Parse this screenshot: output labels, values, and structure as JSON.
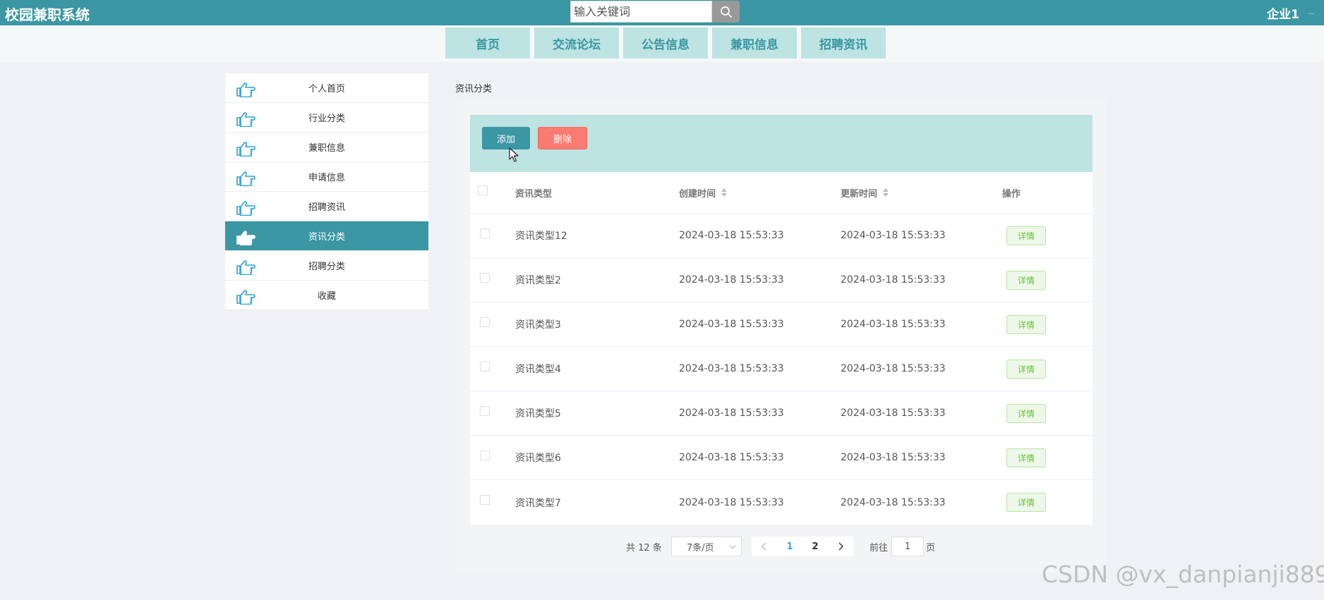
{
  "header": {
    "brand": "校园兼职系统",
    "search_placeholder": "输入关键词",
    "user": "企业1"
  },
  "nav": {
    "items": [
      {
        "label": "首页"
      },
      {
        "label": "交流论坛"
      },
      {
        "label": "公告信息"
      },
      {
        "label": "兼职信息"
      },
      {
        "label": "招聘资讯"
      }
    ]
  },
  "sidebar": {
    "items": [
      {
        "label": "个人首页",
        "icon": "pointing-hand-icon"
      },
      {
        "label": "行业分类",
        "icon": "pointing-hand-icon"
      },
      {
        "label": "兼职信息",
        "icon": "pointing-hand-icon"
      },
      {
        "label": "申请信息",
        "icon": "pointing-hand-icon"
      },
      {
        "label": "招聘资讯",
        "icon": "pointing-hand-icon"
      },
      {
        "label": "资讯分类",
        "icon": "pointing-hand-icon",
        "active": true
      },
      {
        "label": "招聘分类",
        "icon": "pointing-hand-icon"
      },
      {
        "label": "收藏",
        "icon": "pointing-hand-icon"
      }
    ]
  },
  "content": {
    "breadcrumb": "资讯分类",
    "add_label": "添加",
    "delete_label": "删除",
    "columns": {
      "type": "资讯类型",
      "created": "创建时间",
      "updated": "更新时间",
      "action": "操作"
    },
    "rows": [
      {
        "type": "资讯类型12",
        "created": "2024-03-18 15:53:33",
        "updated": "2024-03-18 15:53:33",
        "action": "详情"
      },
      {
        "type": "资讯类型2",
        "created": "2024-03-18 15:53:33",
        "updated": "2024-03-18 15:53:33",
        "action": "详情"
      },
      {
        "type": "资讯类型3",
        "created": "2024-03-18 15:53:33",
        "updated": "2024-03-18 15:53:33",
        "action": "详情"
      },
      {
        "type": "资讯类型4",
        "created": "2024-03-18 15:53:33",
        "updated": "2024-03-18 15:53:33",
        "action": "详情"
      },
      {
        "type": "资讯类型5",
        "created": "2024-03-18 15:53:33",
        "updated": "2024-03-18 15:53:33",
        "action": "详情"
      },
      {
        "type": "资讯类型6",
        "created": "2024-03-18 15:53:33",
        "updated": "2024-03-18 15:53:33",
        "action": "详情"
      },
      {
        "type": "资讯类型7",
        "created": "2024-03-18 15:53:33",
        "updated": "2024-03-18 15:53:33",
        "action": "详情"
      }
    ]
  },
  "pagination": {
    "total": "共 12 条",
    "page_size": "7条/页",
    "pages": [
      "1",
      "2"
    ],
    "current": "1",
    "goto_label": "前往",
    "goto_value": "1",
    "goto_suffix": "页"
  },
  "watermark": "CSDN @vx_danpianji889",
  "colors": {
    "primary": "#3a97a3",
    "light": "#bde3e2",
    "danger": "#fb7b72",
    "success": "#67c23a"
  }
}
